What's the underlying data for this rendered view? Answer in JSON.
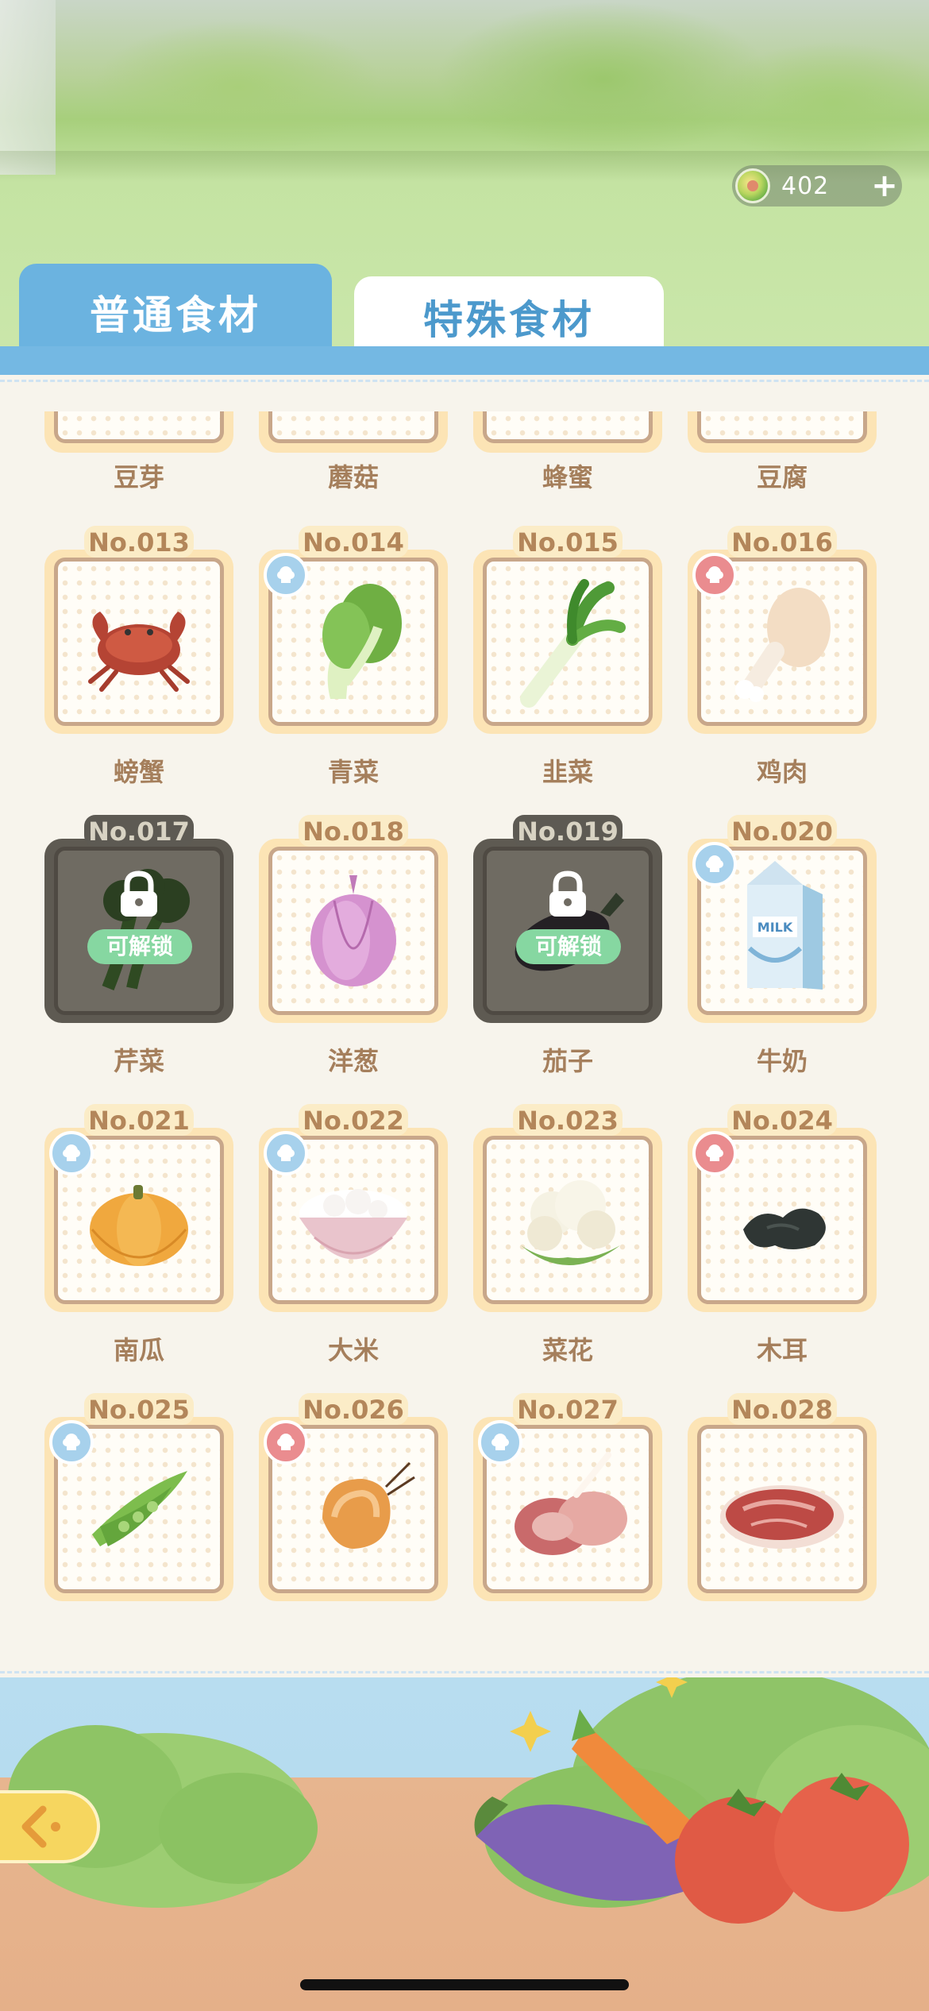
{
  "currency": {
    "amount": "402",
    "icon": "coin-icon"
  },
  "tabs": [
    {
      "label": "普通食材",
      "active": true
    },
    {
      "label": "特殊食材",
      "active": false
    }
  ],
  "top_row": [
    {
      "name": "豆芽"
    },
    {
      "name": "蘑菇"
    },
    {
      "name": "蜂蜜"
    },
    {
      "name": "豆腐"
    }
  ],
  "ingredients": [
    {
      "no": "No.013",
      "name": "螃蟹",
      "badge": "",
      "locked": false,
      "icon": "crab"
    },
    {
      "no": "No.014",
      "name": "青菜",
      "badge": "blue",
      "locked": false,
      "icon": "bok-choy"
    },
    {
      "no": "No.015",
      "name": "韭菜",
      "badge": "",
      "locked": false,
      "icon": "leek"
    },
    {
      "no": "No.016",
      "name": "鸡肉",
      "badge": "red",
      "locked": false,
      "icon": "chicken-leg"
    },
    {
      "no": "No.017",
      "name": "芹菜",
      "badge": "",
      "locked": true,
      "icon": "celery"
    },
    {
      "no": "No.018",
      "name": "洋葱",
      "badge": "",
      "locked": false,
      "icon": "onion"
    },
    {
      "no": "No.019",
      "name": "茄子",
      "badge": "",
      "locked": true,
      "icon": "eggplant"
    },
    {
      "no": "No.020",
      "name": "牛奶",
      "badge": "blue",
      "locked": false,
      "icon": "milk-carton"
    },
    {
      "no": "No.021",
      "name": "南瓜",
      "badge": "blue",
      "locked": false,
      "icon": "pumpkin"
    },
    {
      "no": "No.022",
      "name": "大米",
      "badge": "blue",
      "locked": false,
      "icon": "rice-bowl"
    },
    {
      "no": "No.023",
      "name": "菜花",
      "badge": "",
      "locked": false,
      "icon": "cauliflower"
    },
    {
      "no": "No.024",
      "name": "木耳",
      "badge": "red",
      "locked": false,
      "icon": "wood-ear"
    },
    {
      "no": "No.025",
      "name": "",
      "badge": "blue",
      "locked": false,
      "icon": "pea-pods"
    },
    {
      "no": "No.026",
      "name": "",
      "badge": "red",
      "locked": false,
      "icon": "shrimp"
    },
    {
      "no": "No.027",
      "name": "",
      "badge": "blue",
      "locked": false,
      "icon": "lamb-chops"
    },
    {
      "no": "No.028",
      "name": "",
      "badge": "",
      "locked": false,
      "icon": "beef-steak"
    }
  ],
  "unlock_label": "可解锁",
  "milk_text": "MILK",
  "colors": {
    "accent": "#6bb3e0",
    "frame": "#fce4b5",
    "label": "#a57f5c",
    "unlock": "#86d7a1"
  }
}
